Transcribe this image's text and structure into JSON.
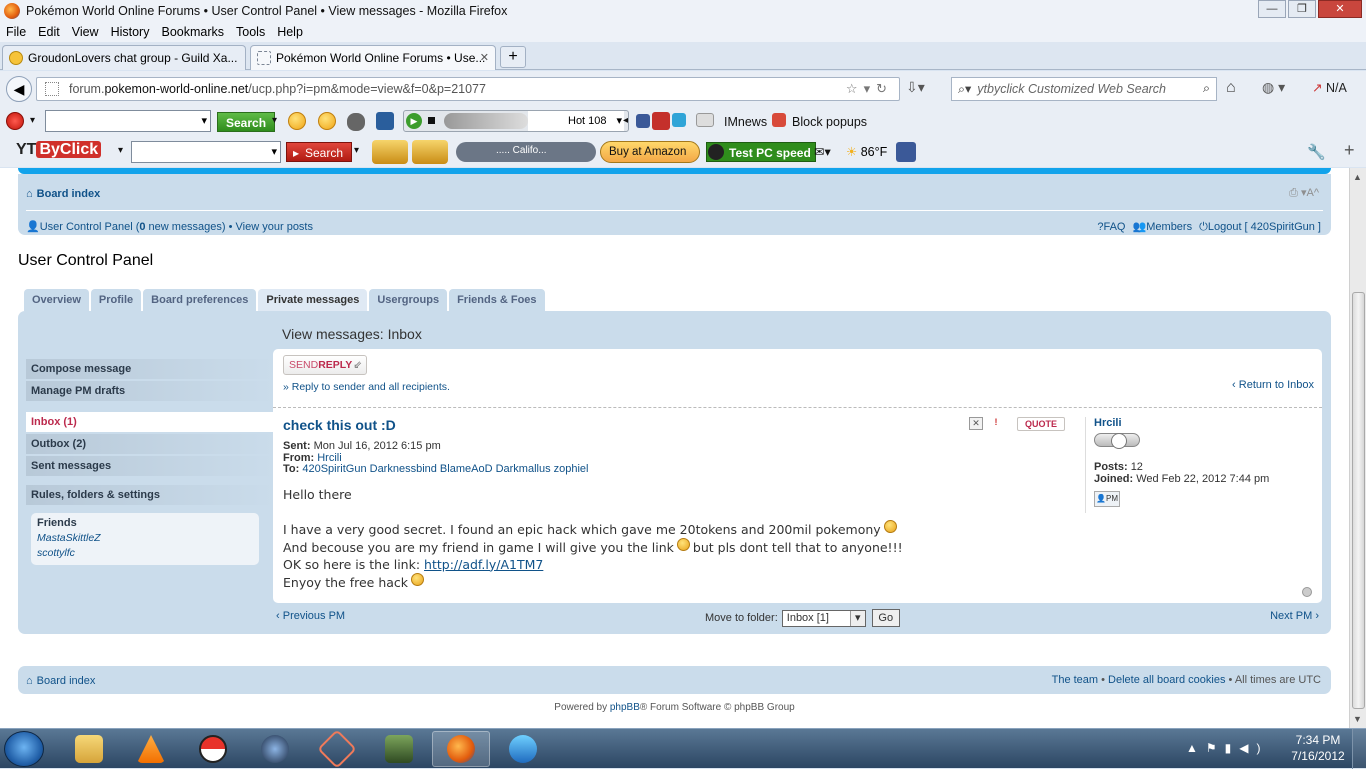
{
  "window": {
    "title": "Pokémon World Online Forums • User Control Panel • View messages - Mozilla Firefox"
  },
  "menu": [
    "File",
    "Edit",
    "View",
    "History",
    "Bookmarks",
    "Tools",
    "Help"
  ],
  "tabs": [
    {
      "label": "GroudonLovers chat group - Guild Xa..."
    },
    {
      "label": "Pokémon World Online Forums • Use..."
    }
  ],
  "address": {
    "prefix": "forum.",
    "host": "pokemon-world-online.net",
    "path": "/ucp.php?i=pm&mode=view&f=0&p=21077"
  },
  "search": {
    "placeholder": "ytbyclick Customized Web Search"
  },
  "toolbar": {
    "search_button": "Search",
    "radio_station": "Hot 108",
    "imnews": "IMnews",
    "block_popups": "Block popups",
    "ytbyclick_logo": "YT",
    "ytbyclick_logo_b": "ByClick",
    "search_button2": "Search",
    "player_text": "..... Califo...",
    "buy_amazon": "Buy at Amazon",
    "test_pc": "Test PC speed",
    "temperature": "86°F",
    "na": "N/A"
  },
  "forum": {
    "board_index": "Board index",
    "ucp_link": "User Control Panel (",
    "new_msgs_count": "0",
    "new_msgs_suffix": " new messages)",
    "bullet": " • ",
    "view_posts": "View your posts",
    "faq": "FAQ",
    "members": "Members",
    "logout": "Logout [ 420SpiritGun ]",
    "ucp_title": "User Control Panel",
    "ucp_tabs": [
      "Overview",
      "Profile",
      "Board preferences",
      "Private messages",
      "Usergroups",
      "Friends & Foes"
    ],
    "left_menu": {
      "compose": "Compose message",
      "drafts": "Manage PM drafts",
      "inbox": "Inbox (1)",
      "outbox": "Outbox (2)",
      "sent": "Sent messages",
      "rules": "Rules, folders & settings"
    },
    "friends": {
      "header": "Friends",
      "list": [
        "MastaSkittleZ",
        "scottylfc"
      ]
    },
    "view_title": "View messages: Inbox",
    "send_reply": {
      "a": "SEND",
      "b": "REPLY"
    },
    "reply_all": "» Reply to sender and all recipients.",
    "return_inbox": "Return to Inbox",
    "message": {
      "subject": "check this out :D",
      "sent_label": "Sent:",
      "sent": "Mon Jul 16, 2012 6:15 pm",
      "from_label": "From:",
      "from": "Hrcili",
      "to_label": "To:",
      "to": "420SpiritGun Darknessbind BlameAoD Darkmallus zophiel",
      "quote": "QUOTE",
      "line1": "Hello there",
      "line2": "I have a very good secret. I found an epic hack which gave me 20tokens and 200mil pokemony",
      "line3a": "And becouse you are my friend in game I will give you the link",
      "line3b": "but pls dont tell that to anyone!!!",
      "line4a": "OK so here is the link: ",
      "link": "http://adf.ly/A1TM7",
      "line5": "Enyoy the free hack"
    },
    "author": {
      "name": "Hrcili",
      "posts_label": "Posts:",
      "posts": "12",
      "joined_label": "Joined:",
      "joined": "Wed Feb 22, 2012 7:44 pm",
      "pm": "PM"
    },
    "prev_pm": "Previous PM",
    "next_pm": "Next PM",
    "move_label": "Move to folder:",
    "move_value": "Inbox [1]",
    "go": "Go",
    "footer": {
      "team": "The team",
      "delete_cookies": "Delete all board cookies",
      "times": "All times are UTC"
    },
    "powered": {
      "a": "Powered by ",
      "b": "phpBB",
      "c": "® Forum Software © phpBB Group"
    }
  },
  "clock": {
    "time": "7:34 PM",
    "date": "7/16/2012"
  }
}
